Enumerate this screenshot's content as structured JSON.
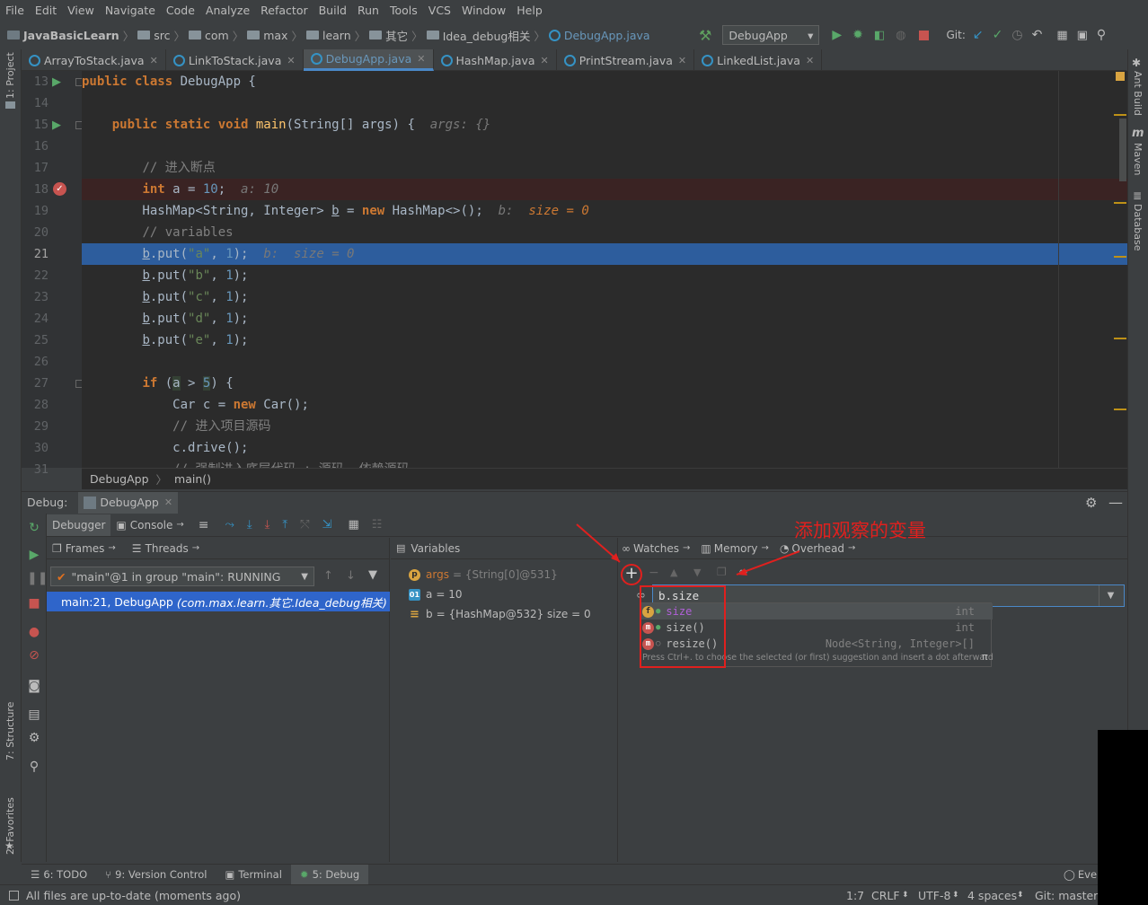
{
  "menu": [
    "File",
    "Edit",
    "View",
    "Navigate",
    "Code",
    "Analyze",
    "Refactor",
    "Build",
    "Run",
    "Tools",
    "VCS",
    "Window",
    "Help"
  ],
  "breadcrumb": {
    "project": "JavaBasicLearn",
    "items": [
      "src",
      "com",
      "max",
      "learn",
      "其它",
      "Idea_debug相关"
    ],
    "file": "DebugApp.java"
  },
  "run_config": "DebugApp",
  "git_label": "Git:",
  "tabs": [
    "ArrayToStack.java",
    "LinkToStack.java",
    "DebugApp.java",
    "HashMap.java",
    "PrintStream.java",
    "LinkedList.java"
  ],
  "left_tools": [
    "1: Project",
    "7: Structure",
    "2: Favorites"
  ],
  "right_tools": [
    "Ant Build",
    "Maven",
    "Database"
  ],
  "code": {
    "line_numbers": [
      "13",
      "14",
      "15",
      "16",
      "17",
      "18",
      "19",
      "20",
      "21",
      "22",
      "23",
      "24",
      "25",
      "26",
      "27",
      "28",
      "29",
      "30",
      "31"
    ],
    "current_line": "21",
    "breakpoint_line": "18"
  },
  "editor_crumbs": [
    "DebugApp",
    "main()"
  ],
  "debug": {
    "title": "Debug:",
    "session": "DebugApp",
    "toolbar_tabs": [
      "Debugger",
      "Console"
    ],
    "panels": {
      "frames": "Frames",
      "threads": "Threads",
      "variables": "Variables",
      "watches": "Watches",
      "memory": "Memory",
      "overhead": "Overhead"
    },
    "thread_select": "\"main\"@1 in group \"main\": RUNNING",
    "frame": "main:21, DebugApp",
    "frame_pkg": "(com.max.learn.其它.Idea_debug相关)",
    "variables": [
      {
        "badge": "p",
        "name": "args",
        "value": "= {String[0]@531}"
      },
      {
        "badge": "01",
        "name": "a",
        "value": "= 10"
      },
      {
        "badge": "≡",
        "name": "b",
        "value": "= {HashMap@532}  size = 0"
      }
    ],
    "watch_input": "b.size",
    "autocomplete": [
      {
        "badge": "f",
        "name": "size",
        "type": "int"
      },
      {
        "badge": "m",
        "name": "size()",
        "type": "int"
      },
      {
        "badge": "m",
        "name": "resize()",
        "type": "Node<String, Integer>[]"
      }
    ],
    "autocomplete_hint": "Press Ctrl+. to choose the selected (or first) suggestion and insert a dot afterward",
    "autocomplete_pi": "π",
    "annotation": "添加观察的变量"
  },
  "bottom_tabs": [
    "6: TODO",
    "9: Version Control",
    "Terminal",
    "5: Debug"
  ],
  "event_log": "Event",
  "status": {
    "message": "All files are up-to-date (moments ago)",
    "pos": "1:7",
    "crlf": "CRLF",
    "enc": "UTF-8",
    "indent": "4 spaces",
    "git": "Git: master"
  },
  "colors": {
    "accent": "#4a88c7",
    "selection": "#2d5d9d",
    "annotation": "#e0201e",
    "keyword": "#cc7832"
  }
}
